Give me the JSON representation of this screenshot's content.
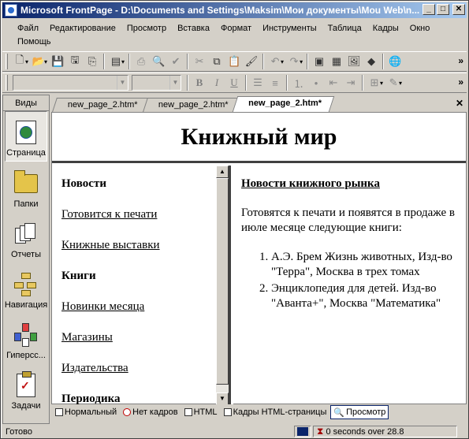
{
  "window": {
    "title": "Microsoft FrontPage - D:\\Documents and Settings\\Maksim\\Мои документы\\Mou Web\\n..."
  },
  "menu": [
    "Файл",
    "Редактирование",
    "Просмотр",
    "Вставка",
    "Формат",
    "Инструменты",
    "Таблица",
    "Кадры",
    "Окно",
    "Помощь"
  ],
  "views": {
    "header": "Виды",
    "items": [
      {
        "label": "Страница",
        "icon": "page-view-icon",
        "active": true
      },
      {
        "label": "Папки",
        "icon": "folders-icon"
      },
      {
        "label": "Отчеты",
        "icon": "reports-icon"
      },
      {
        "label": "Навигация",
        "icon": "navigation-icon"
      },
      {
        "label": "Гиперсс...",
        "icon": "hyperlinks-icon"
      },
      {
        "label": "Задачи",
        "icon": "tasks-icon"
      }
    ]
  },
  "tabs": [
    {
      "label": "new_page_2.htm*"
    },
    {
      "label": "new_page_2.htm*"
    },
    {
      "label": "new_page_2.htm*",
      "active": true
    }
  ],
  "page": {
    "banner_title": "Книжный мир",
    "left_links": [
      {
        "text": "Новости",
        "bold": true,
        "underline": false
      },
      {
        "text": "Готовится к печати",
        "bold": false,
        "underline": true
      },
      {
        "text": "Книжные выставки",
        "bold": false,
        "underline": true
      },
      {
        "text": "Книги",
        "bold": true,
        "underline": false
      },
      {
        "text": "Новинки месяца",
        "bold": false,
        "underline": true
      },
      {
        "text": "Магазины",
        "bold": false,
        "underline": true
      },
      {
        "text": "Издательства",
        "bold": false,
        "underline": true
      },
      {
        "text": "Периодика",
        "bold": true,
        "underline": false
      }
    ],
    "right_heading": "Новости книжного рынка",
    "right_paragraph": "Готовятся к печати и появятся в продаже в июле месяце следующие книги:",
    "right_list": [
      "А.Э. Брем Жизнь животных, Изд-во \"Терра\", Москва в трех томах",
      "Энциклопедия для детей. Изд-во \"Аванта+\", Москва \"Математика\""
    ]
  },
  "view_tabs": [
    {
      "label": "Нормальный"
    },
    {
      "label": "Нет кадров",
      "red": true
    },
    {
      "label": "HTML"
    },
    {
      "label": "Кадры HTML-страницы"
    },
    {
      "label": "Просмотр",
      "active": true
    }
  ],
  "status": {
    "text": "Готово",
    "timing": "0 seconds over 28.8"
  }
}
